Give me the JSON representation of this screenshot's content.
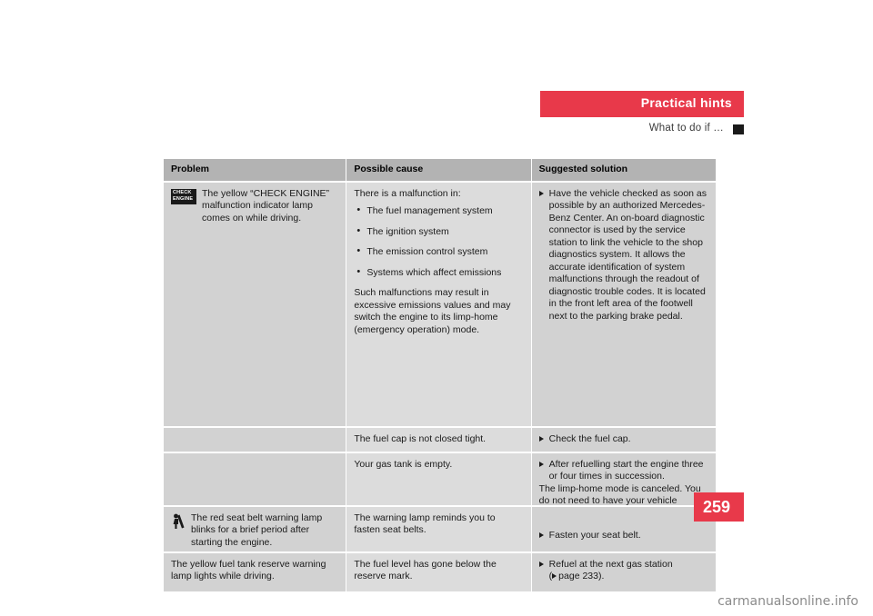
{
  "header": {
    "title": "Practical hints",
    "subtitle": "What to do if …"
  },
  "table": {
    "columns": [
      "Problem",
      "Possible cause",
      "Suggested solution"
    ],
    "rows": [
      {
        "icon": "check-engine-icon",
        "icon_label_line1": "CHECK",
        "icon_label_line2": "ENGINE",
        "problem": "The yellow “CHECK ENGINE” malfunction indicator lamp comes on while driving.",
        "cause_intro": "There is a malfunction in:",
        "cause_bullets": [
          "The fuel management system",
          "The ignition system",
          "The emission control system",
          "Systems which affect emissions"
        ],
        "cause_after": "Such malfunctions may result in excessive emissions values and may switch the engine to its limp-home (emergency operation) mode.",
        "solution": "Have the vehicle checked as soon as possible by an authorized Mercedes-Benz Center.\nAn on-board diagnostic connector is used by the service station to link the vehicle to the shop diagnostics system. It allows the accurate identification of system malfunctions through the readout of diagnostic trouble codes. It is located in the front left area of the footwell next to the parking brake pedal."
      },
      {
        "problem": "",
        "cause": "The fuel cap is not closed tight.",
        "solution": "Check the fuel cap."
      },
      {
        "problem": "",
        "cause": "Your gas tank is empty.",
        "solution": "After refuelling start the engine three or four times in succession.",
        "solution_after": "The limp-home mode is canceled. You do not need to have your vehicle checked."
      },
      {
        "icon": "seatbelt-icon",
        "problem": "The red seat belt warning lamp blinks for a brief period after starting the engine.",
        "cause": "The warning lamp reminds you to fasten seat belts.",
        "solution": "Fasten your seat belt."
      },
      {
        "problem": "The yellow fuel tank reserve warning lamp lights while driving.",
        "cause": "The fuel level has gone below the reserve mark.",
        "solution": "Refuel at the next gas station",
        "solution_ref": "page 233)."
      }
    ]
  },
  "page_number": "259",
  "watermark": "carmanualsonline.info"
}
